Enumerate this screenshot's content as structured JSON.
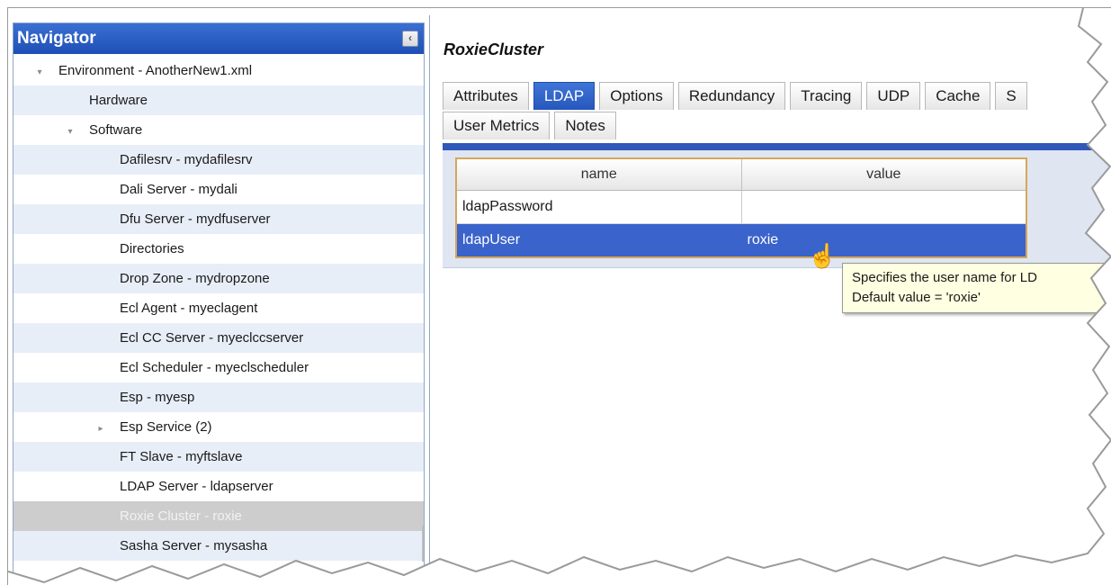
{
  "navigator": {
    "title": "Navigator",
    "collapse_glyph": "‹",
    "tree": [
      {
        "label": "Environment - AnotherNew1.xml",
        "level": 1,
        "twisty": "▾",
        "alt": false,
        "selected": false
      },
      {
        "label": "Hardware",
        "level": 2,
        "twisty": "",
        "alt": true,
        "selected": false
      },
      {
        "label": "Software",
        "level": 2,
        "twisty": "▾",
        "alt": false,
        "selected": false
      },
      {
        "label": "Dafilesrv - mydafilesrv",
        "level": 3,
        "twisty": "",
        "alt": true,
        "selected": false
      },
      {
        "label": "Dali Server - mydali",
        "level": 3,
        "twisty": "",
        "alt": false,
        "selected": false
      },
      {
        "label": "Dfu Server - mydfuserver",
        "level": 3,
        "twisty": "",
        "alt": true,
        "selected": false
      },
      {
        "label": "Directories",
        "level": 3,
        "twisty": "",
        "alt": false,
        "selected": false
      },
      {
        "label": "Drop Zone - mydropzone",
        "level": 3,
        "twisty": "",
        "alt": true,
        "selected": false
      },
      {
        "label": "Ecl Agent - myeclagent",
        "level": 3,
        "twisty": "",
        "alt": false,
        "selected": false
      },
      {
        "label": "Ecl CC Server - myeclccserver",
        "level": 3,
        "twisty": "",
        "alt": true,
        "selected": false
      },
      {
        "label": "Ecl Scheduler - myeclscheduler",
        "level": 3,
        "twisty": "",
        "alt": false,
        "selected": false
      },
      {
        "label": "Esp - myesp",
        "level": 3,
        "twisty": "",
        "alt": true,
        "selected": false
      },
      {
        "label": "Esp Service (2)",
        "level": 3,
        "twisty": "▸",
        "alt": false,
        "selected": false
      },
      {
        "label": "FT Slave - myftslave",
        "level": 3,
        "twisty": "",
        "alt": true,
        "selected": false
      },
      {
        "label": "LDAP Server - ldapserver",
        "level": 3,
        "twisty": "",
        "alt": false,
        "selected": false
      },
      {
        "label": "Roxie Cluster - roxie",
        "level": 3,
        "twisty": "",
        "alt": false,
        "selected": true
      },
      {
        "label": "Sasha Server - mysasha",
        "level": 3,
        "twisty": "",
        "alt": true,
        "selected": false
      }
    ]
  },
  "detail": {
    "title": "RoxieCluster",
    "tabs_row1": [
      "Attributes",
      "LDAP",
      "Options",
      "Redundancy",
      "Tracing",
      "UDP",
      "Cache",
      "S"
    ],
    "tabs_row2": [
      "User Metrics",
      "Notes"
    ],
    "active_tab": "LDAP",
    "grid": {
      "columns": [
        "name",
        "value"
      ],
      "rows": [
        {
          "name": "ldapPassword",
          "value": "",
          "selected": false
        },
        {
          "name": "ldapUser",
          "value": "roxie",
          "selected": true
        }
      ]
    },
    "tooltip": {
      "line1": "Specifies the user name for LD",
      "line2": "Default value = 'roxie'"
    },
    "cursor_glyph": "☝"
  },
  "colors": {
    "accent": "#2657bd",
    "selection": "#3a63cc",
    "tooltip_bg": "#ffffe1"
  }
}
